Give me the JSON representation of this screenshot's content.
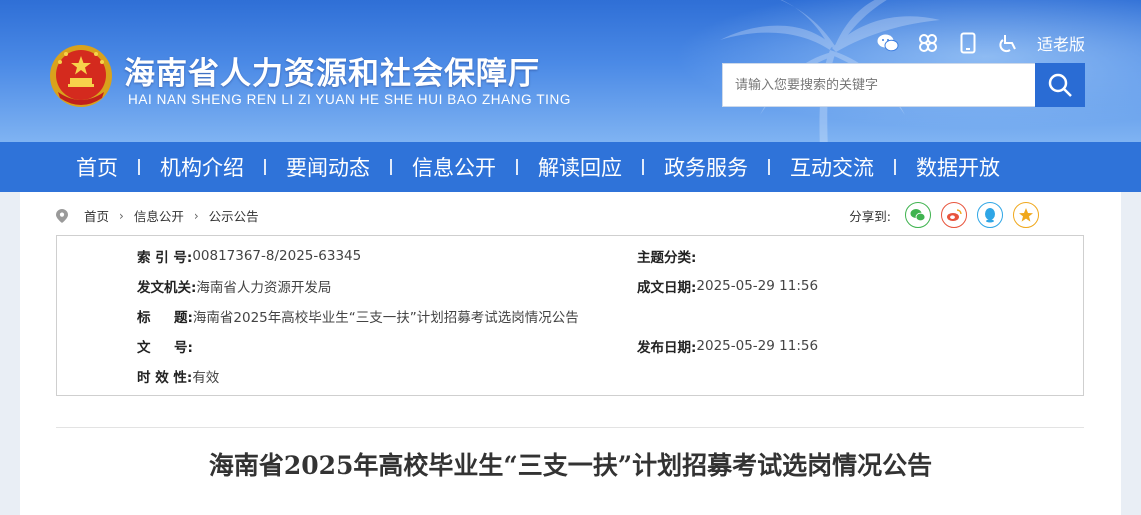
{
  "header": {
    "title": "海南省人力资源和社会保障厅",
    "subtitle": "HAI NAN SHENG REN LI ZI YUAN HE SHE HUI BAO ZHANG TING",
    "elder_mode": "适老版",
    "icons": [
      "wechat-icon",
      "miniapp-icon",
      "mobile-icon",
      "accessibility-icon"
    ]
  },
  "search": {
    "placeholder": "请输入您要搜索的关键字"
  },
  "nav": {
    "items": [
      "首页",
      "机构介绍",
      "要闻动态",
      "信息公开",
      "解读回应",
      "政务服务",
      "互动交流",
      "数据开放"
    ]
  },
  "breadcrumb": {
    "items": [
      "首页",
      "信息公开",
      "公示公告"
    ]
  },
  "share": {
    "label": "分享到:",
    "targets": [
      "wechat",
      "weibo",
      "qq",
      "qzone"
    ]
  },
  "meta": {
    "index_label": "索 引 号:",
    "index_value": "00817367-8/2025-63345",
    "topic_label": "主题分类:",
    "topic_value": "",
    "issuer_label": "发文机关:",
    "issuer_value": "海南省人力资源开发局",
    "created_label": "成文日期:",
    "created_value": "2025-05-29 11:56",
    "title_label": "标     题:",
    "title_value": "海南省2025年高校毕业生“三支一扶”计划招募考试选岗情况公告",
    "docno_label": "文     号:",
    "docno_value": "",
    "published_label": "发布日期:",
    "published_value": "2025-05-29 11:56",
    "validity_label": "时 效 性:",
    "validity_value": "有效"
  },
  "article": {
    "title": "海南省2025年高校毕业生“三支一扶”计划招募考试选岗情况公告"
  },
  "colors": {
    "nav_bg": "#2f73d9",
    "search_btn": "#2a6cd4",
    "wechat": "#3fb34f",
    "weibo": "#e8543c",
    "qq": "#2fa6e6",
    "qzone": "#f0a81c"
  }
}
